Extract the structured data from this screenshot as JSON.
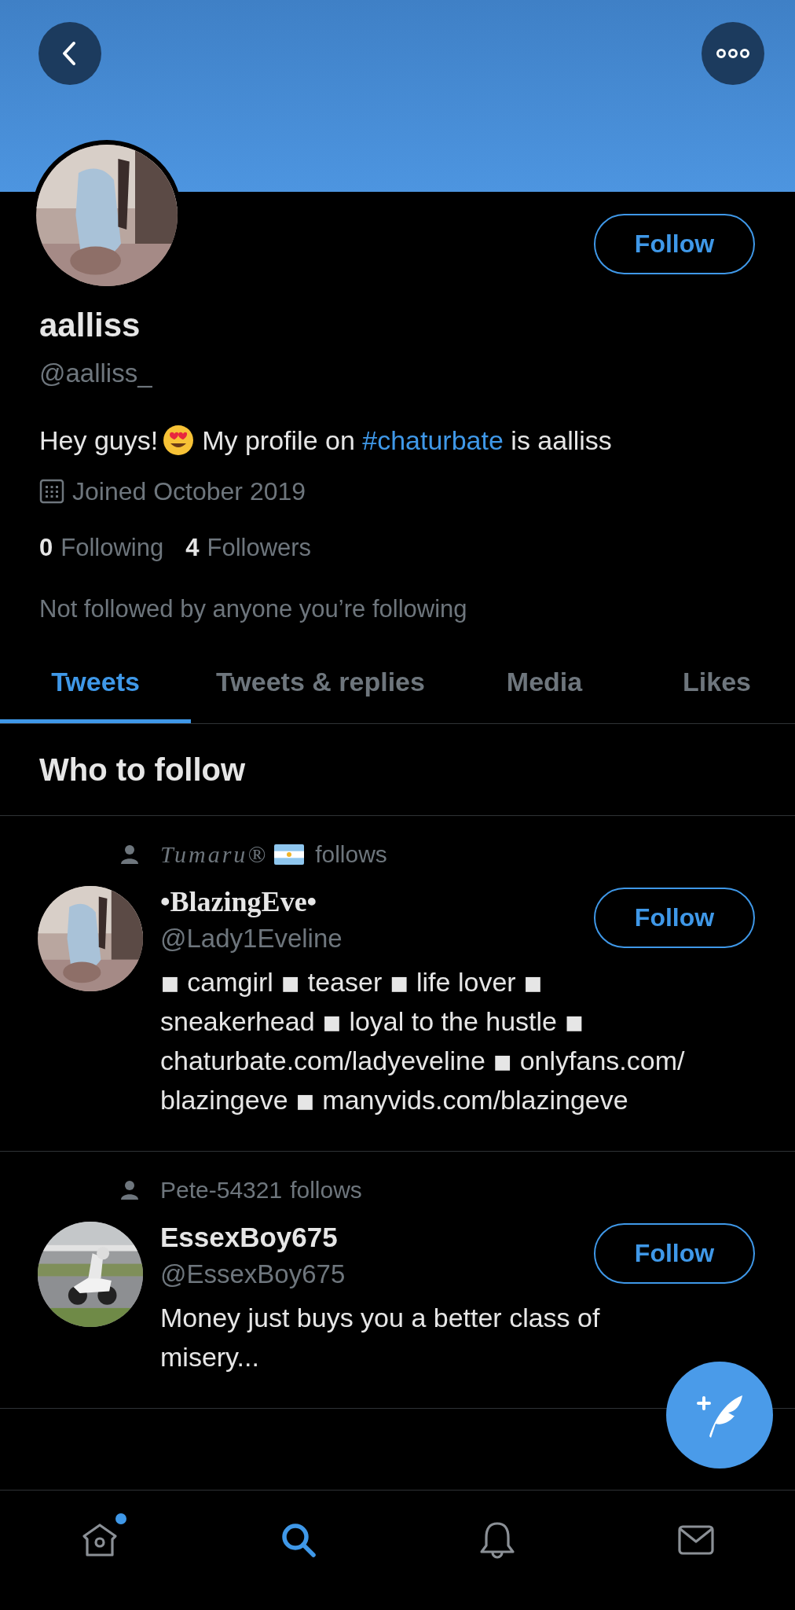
{
  "profile": {
    "name": "aalliss",
    "handle": "@aalliss_",
    "bio_start": "Hey guys!",
    "bio_middle": "My profile on",
    "bio_hashtag": "#chaturbate",
    "bio_end": "is aalliss",
    "joined": "Joined October 2019",
    "following_count": "0",
    "following_label": "Following",
    "followers_count": "4",
    "followers_label": "Followers",
    "followed_by": "Not followed by anyone you’re following",
    "follow_button": "Follow"
  },
  "tabs": [
    {
      "label": "Tweets",
      "selected": true
    },
    {
      "label": "Tweets & replies",
      "selected": false
    },
    {
      "label": "Media",
      "selected": false
    },
    {
      "label": "Likes",
      "selected": false
    }
  ],
  "who_to_follow": {
    "title": "Who to follow",
    "suggestions": [
      {
        "kind": "fancy",
        "context": {
          "name": "Tumaru®",
          "flag": true,
          "verb": "follows"
        },
        "name": "•BlazingEve•",
        "handle": "@Lady1Eveline",
        "bio": "◾ camgirl ◾ teaser ◾ life lover ◾ sneakerhead ◾ loyal to the hustle ◾  chaturbate.com/ladyeveline ◾ onlyfans.com/ blazingeve ◾ manyvids.com/blazingeve",
        "button": "Follow"
      },
      {
        "kind": "plain",
        "context": {
          "name": "Pete-54321",
          "flag": false,
          "verb": "follows"
        },
        "name": "EssexBoy675",
        "handle": "@EssexBoy675",
        "bio": "Money just buys you a better class of misery...",
        "button": "Follow"
      }
    ]
  },
  "nav": [
    {
      "kind": "home",
      "selected": false,
      "badge": true
    },
    {
      "kind": "search",
      "selected": true,
      "badge": false
    },
    {
      "kind": "notifications",
      "selected": false,
      "badge": false
    },
    {
      "kind": "messages",
      "selected": false,
      "badge": false
    }
  ]
}
